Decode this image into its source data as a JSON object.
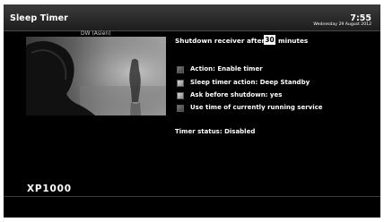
{
  "header": {
    "title": "Sleep Timer",
    "time": "7:55",
    "date": "Wednesday 29 August 2012"
  },
  "preview": {
    "channel": "DW (Asien)"
  },
  "shutdown": {
    "label": "Shutdown receiver after",
    "minutes": "30",
    "unit": "minutes"
  },
  "options": [
    {
      "label": "Action: Enable timer",
      "checked": false
    },
    {
      "label": "Sleep timer action: Deep Standby",
      "checked": true
    },
    {
      "label": "Ask before shutdown: yes",
      "checked": true
    },
    {
      "label": "Use time of currently running service",
      "checked": false
    }
  ],
  "status": "Timer status: Disabled",
  "model": "XP1000"
}
